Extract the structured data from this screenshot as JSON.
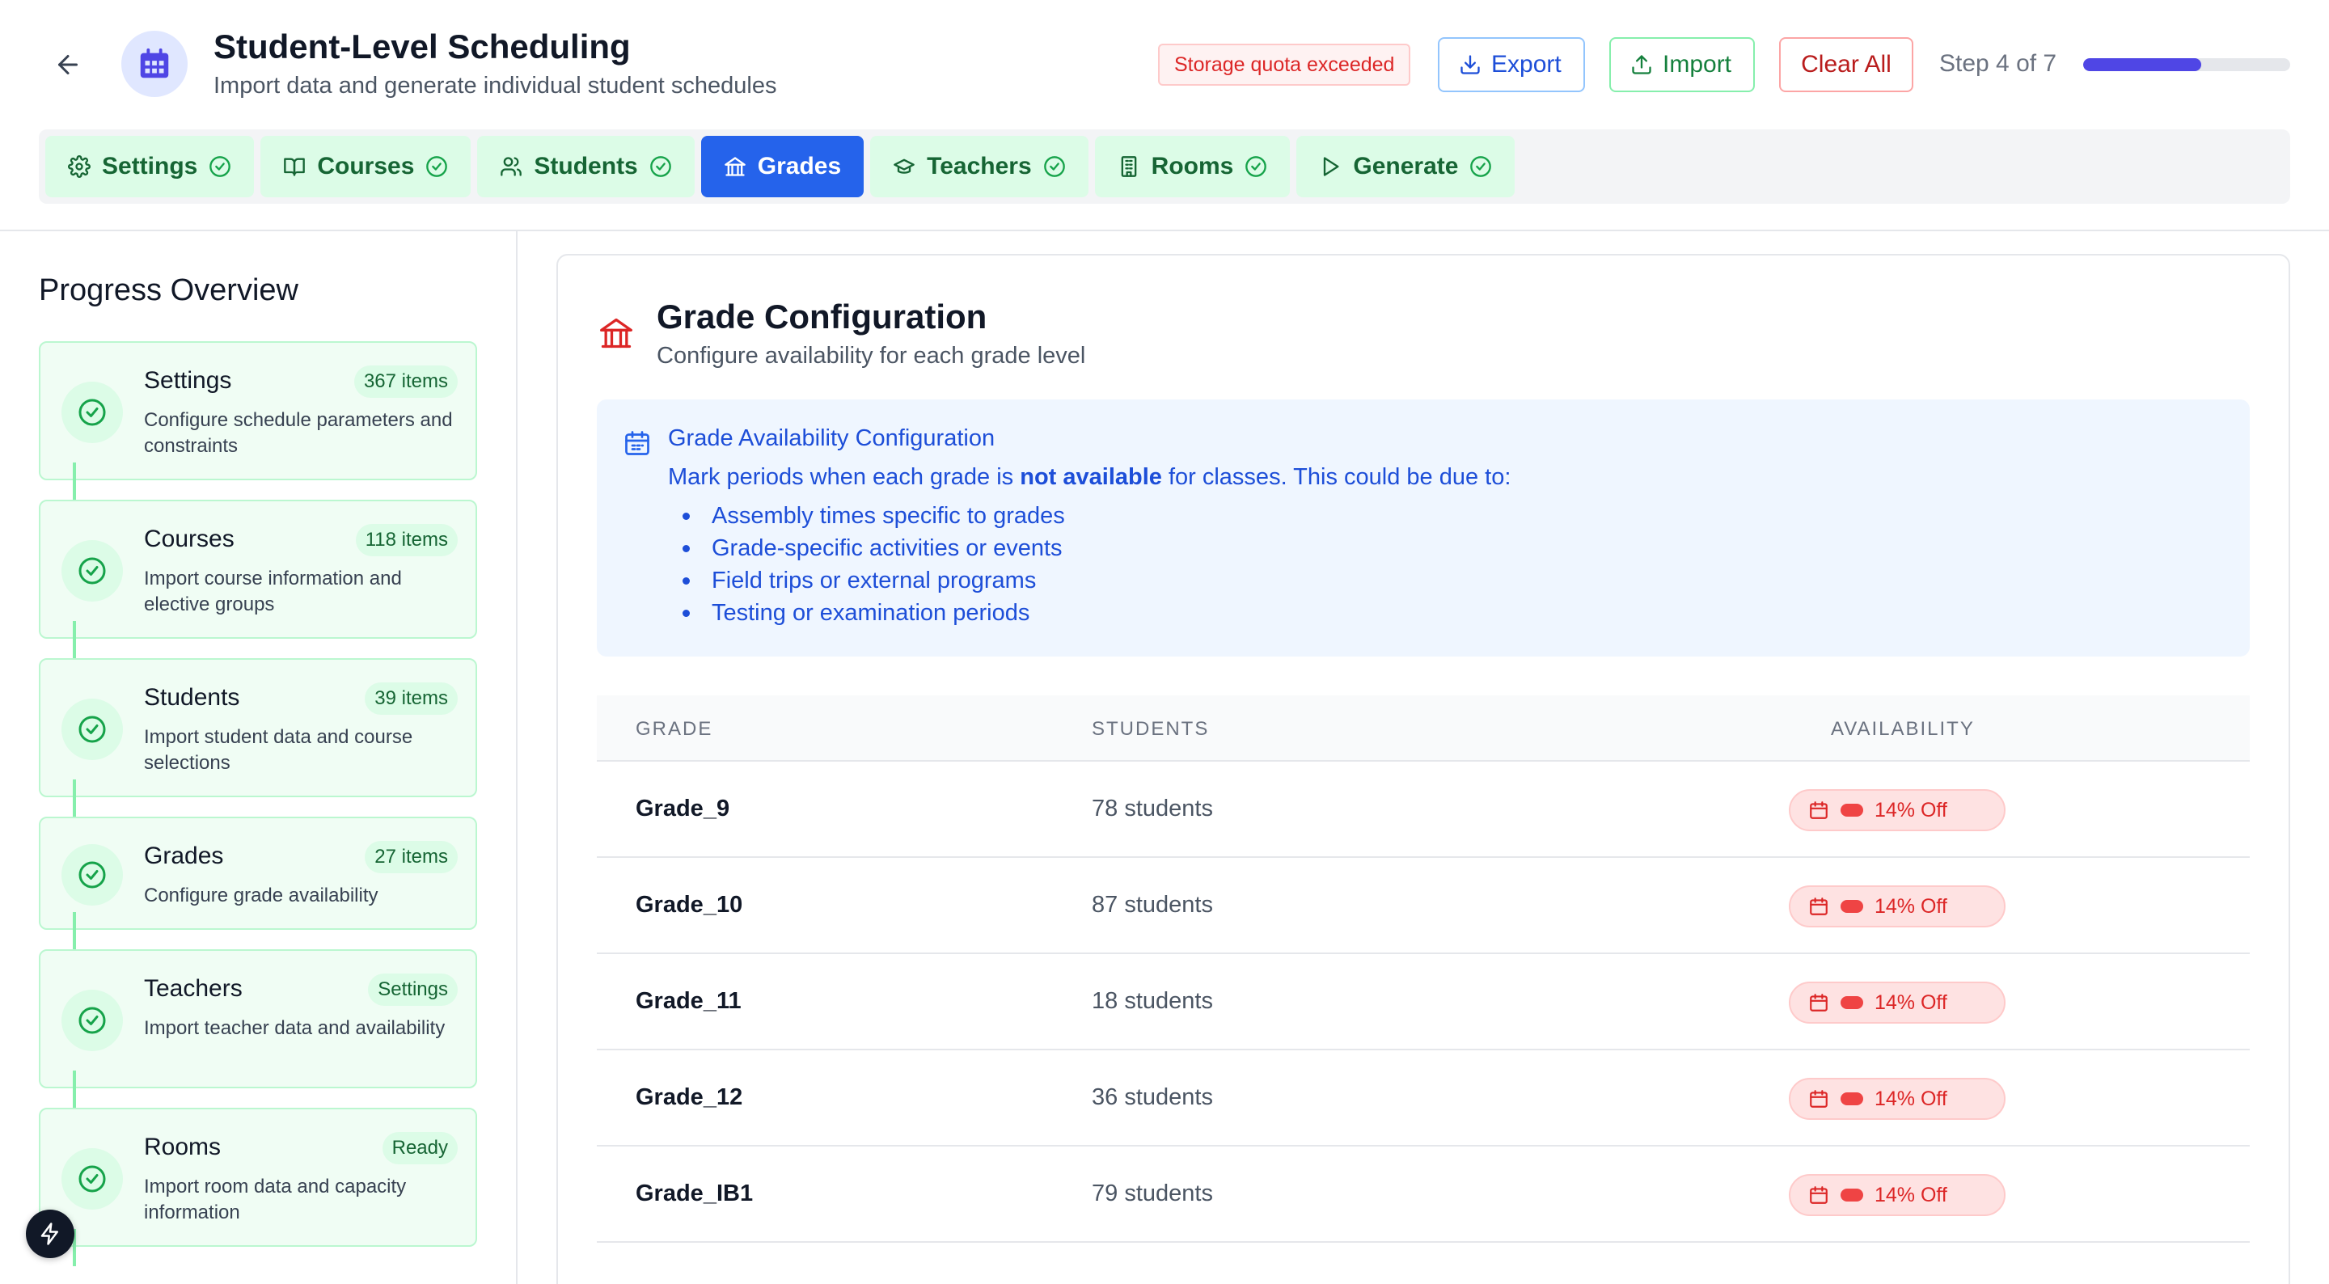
{
  "header": {
    "title": "Student-Level Scheduling",
    "subtitle": "Import data and generate individual student schedules",
    "quota_warning": "Storage quota exceeded",
    "export_label": "Export",
    "import_label": "Import",
    "clear_label": "Clear All",
    "step_label": "Step 4 of 7",
    "progress_fraction": 0.571
  },
  "tabs": [
    {
      "label": "Settings",
      "icon": "gear-icon",
      "state": "done"
    },
    {
      "label": "Courses",
      "icon": "book-icon",
      "state": "done"
    },
    {
      "label": "Students",
      "icon": "users-icon",
      "state": "done"
    },
    {
      "label": "Grades",
      "icon": "building-icon",
      "state": "active"
    },
    {
      "label": "Teachers",
      "icon": "graduation-cap-icon",
      "state": "done"
    },
    {
      "label": "Rooms",
      "icon": "room-building-icon",
      "state": "done"
    },
    {
      "label": "Generate",
      "icon": "play-icon",
      "state": "done"
    }
  ],
  "sidebar": {
    "title": "Progress Overview",
    "steps": [
      {
        "name": "Settings",
        "badge": "367 items",
        "desc": "Configure schedule parameters and constraints"
      },
      {
        "name": "Courses",
        "badge": "118 items",
        "desc": "Import course information and elective groups"
      },
      {
        "name": "Students",
        "badge": "39 items",
        "desc": "Import student data and course selections"
      },
      {
        "name": "Grades",
        "badge": "27 items",
        "desc": "Configure grade availability"
      },
      {
        "name": "Teachers",
        "badge": "Settings",
        "desc": "Import teacher data and availability"
      },
      {
        "name": "Rooms",
        "badge": "Ready",
        "desc": "Import room data and capacity information"
      }
    ]
  },
  "main": {
    "title": "Grade Configuration",
    "subtitle": "Configure availability for each grade level",
    "info": {
      "title": "Grade Availability Configuration",
      "text_before": "Mark periods when each grade is ",
      "text_bold": "not available",
      "text_after": " for classes. This could be due to:",
      "items": [
        "Assembly times specific to grades",
        "Grade-specific activities or events",
        "Field trips or external programs",
        "Testing or examination periods"
      ]
    },
    "table": {
      "headers": {
        "grade": "GRADE",
        "students": "STUDENTS",
        "availability": "AVAILABILITY"
      },
      "rows": [
        {
          "grade": "Grade_9",
          "students": "78 students",
          "availability": "14% Off"
        },
        {
          "grade": "Grade_10",
          "students": "87 students",
          "availability": "14% Off"
        },
        {
          "grade": "Grade_11",
          "students": "18 students",
          "availability": "14% Off"
        },
        {
          "grade": "Grade_12",
          "students": "36 students",
          "availability": "14% Off"
        },
        {
          "grade": "Grade_IB1",
          "students": "79 students",
          "availability": "14% Off"
        }
      ]
    }
  },
  "colors": {
    "accent": "#2563eb",
    "progress": "#4f46e5",
    "done": "#16a34a",
    "danger": "#dc2626"
  }
}
